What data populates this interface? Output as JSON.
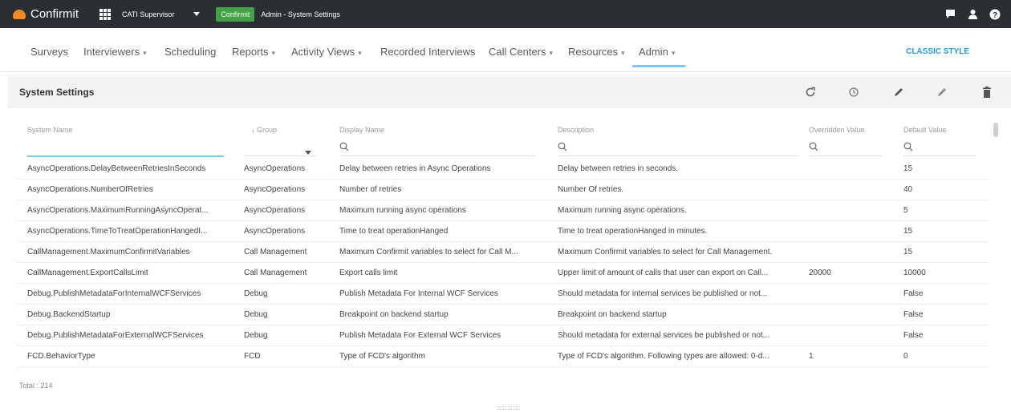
{
  "topbar": {
    "logo_text": "Confirmit",
    "role": "CATI Supervisor",
    "app_badge": "Confirmit",
    "breadcrumb": "Admin - System Settings",
    "icons": [
      "chat-icon",
      "user-icon",
      "help-icon"
    ]
  },
  "nav": {
    "items": [
      {
        "label": "Surveys",
        "dropdown": ""
      },
      {
        "label": "Interviewers",
        "dropdown": "▾"
      },
      {
        "label": "Scheduling",
        "dropdown": ""
      },
      {
        "label": "Reports",
        "dropdown": "▾"
      },
      {
        "label": "Activity Views",
        "dropdown": "▾"
      },
      {
        "label": "Recorded Interviews",
        "dropdown": ""
      },
      {
        "label": "Call Centers",
        "dropdown": "▾"
      },
      {
        "label": "Resources",
        "dropdown": "▾"
      },
      {
        "label": "Admin",
        "dropdown": "▾"
      }
    ],
    "active": "Admin",
    "classic_style": "CLASSIC STYLE"
  },
  "page": {
    "title": "System Settings",
    "tools": [
      "refresh-icon",
      "history-icon",
      "edit-icon",
      "edit-alt-icon",
      "delete-icon"
    ]
  },
  "table": {
    "headers": {
      "system_name": "System Name",
      "group": "↓ Group",
      "display_name": "Display Name",
      "description": "Description",
      "overridden": "Overridden Value",
      "default": "Default Value"
    },
    "rows": [
      {
        "system_name": "AsyncOperations.DelayBetweenRetriesInSeconds",
        "group": "AsyncOperations",
        "display_name": "Delay between retries in Async Operations",
        "description": "Delay between retries in seconds.",
        "overridden": "",
        "default": "15"
      },
      {
        "system_name": "AsyncOperations.NumberOfRetries",
        "group": "AsyncOperations",
        "display_name": "Number of retries",
        "description": "Number Of retries.",
        "overridden": "",
        "default": "40"
      },
      {
        "system_name": "AsyncOperations.MaximumRunningAsyncOperat...",
        "group": "AsyncOperations",
        "display_name": "Maximum running async operations",
        "description": "Maximum running async operations.",
        "overridden": "",
        "default": "5"
      },
      {
        "system_name": "AsyncOperations.TimeToTreatOperationHangedI...",
        "group": "AsyncOperations",
        "display_name": "Time to treat operationHanged",
        "description": "Time to treat operationHanged in minutes.",
        "overridden": "",
        "default": "15"
      },
      {
        "system_name": "CallManagement.MaximumConfirmitVariables",
        "group": "Call Management",
        "display_name": "Maximum Confirmit variables to select for Call M...",
        "description": "Maximum Confirmit variables to select for Call Management.",
        "overridden": "",
        "default": "15"
      },
      {
        "system_name": "CallManagement.ExportCallsLimit",
        "group": "Call Management",
        "display_name": "Export calls limit",
        "description": "Upper limit of amount of calls that user can export on Call...",
        "overridden": "20000",
        "default": "10000"
      },
      {
        "system_name": "Debug.PublishMetadataForInternalWCFServices",
        "group": "Debug",
        "display_name": "Publish Metadata For Internal WCF Services",
        "description": "Should metadata for internal services be published or not...",
        "overridden": "",
        "default": "False"
      },
      {
        "system_name": "Debug.BackendStartup",
        "group": "Debug",
        "display_name": "Breakpoint on backend startup",
        "description": "Breakpoint on backend startup",
        "overridden": "",
        "default": "False"
      },
      {
        "system_name": "Debug.PublishMetadataForExternalWCFServices",
        "group": "Debug",
        "display_name": "Publish Metadata For External WCF Services",
        "description": "Should metadata for external services be published or not...",
        "overridden": "",
        "default": "False"
      },
      {
        "system_name": "FCD.BehaviorType",
        "group": "FCD",
        "display_name": "Type of FCD's algorithm",
        "description": "Type of FCD's algorithm. Following types are allowed: 0-d...",
        "overridden": "1",
        "default": "0"
      }
    ],
    "total": "Total : 214"
  },
  "colors": {
    "topbar_bg": "#2b2f33",
    "accent": "#2a9bd8",
    "badge_green": "#43a047",
    "logo_orange": "#f08a24"
  }
}
